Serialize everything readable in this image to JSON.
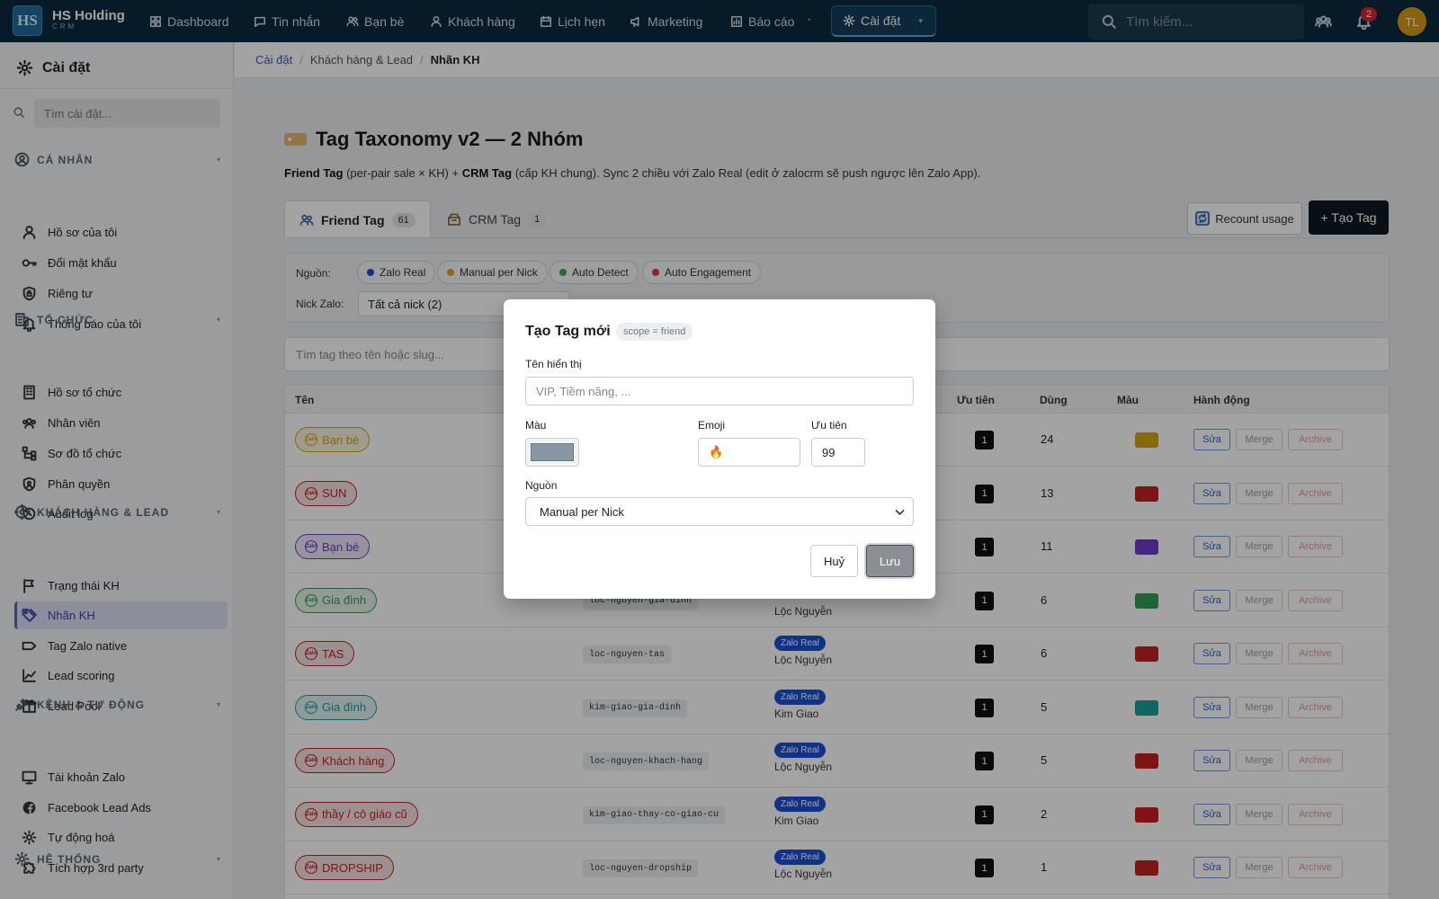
{
  "topnav": {
    "logo": "HS",
    "brand_name": "HS Holding",
    "brand_sub": "CRM",
    "items": [
      {
        "label": "Dashboard"
      },
      {
        "label": "Tin nhắn"
      },
      {
        "label": "Bạn bè"
      },
      {
        "label": "Khách hàng"
      },
      {
        "label": "Lịch hẹn"
      },
      {
        "label": "Marketing"
      },
      {
        "label": "Báo cáo"
      }
    ],
    "active_item": "Cài đặt",
    "search_placeholder": "Tìm kiếm...",
    "notification_count": "2",
    "avatar_initials": "TL"
  },
  "sidebar": {
    "title": "Cài đặt",
    "search_placeholder": "Tìm cài đặt...",
    "sections": [
      {
        "title": "CÁ NHÂN",
        "items": [
          "Hồ sơ của tôi",
          "Đổi mật khẩu",
          "Riêng tư",
          "Thông báo của tôi"
        ]
      },
      {
        "title": "TỔ CHỨC",
        "items": [
          "Hồ sơ tổ chức",
          "Nhân viên",
          "Sơ đồ tổ chức",
          "Phân quyền",
          "Audit log"
        ]
      },
      {
        "title": "KHÁCH HÀNG & LEAD",
        "items": [
          "Trạng thái KH",
          "Nhãn KH",
          "Tag Zalo native",
          "Lead scoring",
          "Lead Pool"
        ]
      },
      {
        "title": "KÊNH & TỰ ĐỘNG",
        "items": [
          "Tài khoản Zalo",
          "Facebook Lead Ads",
          "Tự động hoá",
          "Tích hợp 3rd party"
        ]
      },
      {
        "title": "HỆ THỐNG",
        "items": []
      }
    ],
    "active_item": "Nhãn KH"
  },
  "breadcrumb": [
    "Cài đặt",
    "Khách hàng & Lead",
    "Nhãn KH"
  ],
  "page": {
    "title": "Tag Taxonomy v2 — 2 Nhóm",
    "desc_b1": "Friend Tag",
    "desc_t1": " (per-pair sale × KH) + ",
    "desc_b2": "CRM Tag",
    "desc_t2": " (cấp KH chung). Sync 2 chiều với Zalo Real (edit ở zalocrm sẽ push ngược lên Zalo App).",
    "tabs": [
      {
        "label": "Friend Tag",
        "count": "61"
      },
      {
        "label": "CRM Tag",
        "count": "1"
      }
    ],
    "recount_label": "Recount usage",
    "create_label": "+ Tạo Tag",
    "filters": {
      "source_label": "Nguồn:",
      "sources": [
        {
          "label": "Zalo Real",
          "color": "#1a4fd6"
        },
        {
          "label": "Manual per Nick",
          "color": "#e0a21a"
        },
        {
          "label": "Auto Detect",
          "color": "#3aa756"
        },
        {
          "label": "Auto Engagement",
          "color": "#d63a3a"
        }
      ],
      "nick_label": "Nick Zalo:",
      "nick_value": "Tất cả nick (2)"
    },
    "tag_search_placeholder": "Tìm tag theo tên hoặc slug..."
  },
  "table": {
    "headers": {
      "name": "Tên",
      "priority": "Ưu tiên",
      "used": "Dùng",
      "color": "Màu",
      "actions": "Hành động"
    },
    "action_labels": {
      "edit": "Sửa",
      "merge": "Merge",
      "archive": "Archive"
    },
    "rows": [
      {
        "name": "Bạn bè",
        "slug": "",
        "source": "",
        "nick": "",
        "priority": "1",
        "used": "24",
        "color": "#d4a40c"
      },
      {
        "name": "SUN",
        "slug": "",
        "source": "",
        "nick": "",
        "priority": "1",
        "used": "13",
        "color": "#c81e1e"
      },
      {
        "name": "Bạn bè",
        "slug": "",
        "source": "",
        "nick": "",
        "priority": "1",
        "used": "11",
        "color": "#6d3bc8"
      },
      {
        "name": "Gia đình",
        "slug": "loc-nguyen-gia-dinh",
        "source": "",
        "nick": "Lộc Nguyễn",
        "priority": "1",
        "used": "6",
        "color": "#2e9e55"
      },
      {
        "name": "TAS",
        "slug": "loc-nguyen-tas",
        "source": "Zalo Real",
        "nick": "Lộc Nguyễn",
        "priority": "1",
        "used": "6",
        "color": "#c81e1e"
      },
      {
        "name": "Gia đình",
        "slug": "kim-giao-gia-dinh",
        "source": "Zalo Real",
        "nick": "Kim Giao",
        "priority": "1",
        "used": "5",
        "color": "#14a39a"
      },
      {
        "name": "Khách hàng",
        "slug": "loc-nguyen-khach-hang",
        "source": "Zalo Real",
        "nick": "Lộc Nguyễn",
        "priority": "1",
        "used": "5",
        "color": "#c81e1e"
      },
      {
        "name": "thầy / cô giáo cũ",
        "slug": "kim-giao-thay-co-giao-cu",
        "source": "Zalo Real",
        "nick": "Kim Giao",
        "priority": "1",
        "used": "2",
        "color": "#c81e1e"
      },
      {
        "name": "DROPSHIP",
        "slug": "loc-nguyen-dropship",
        "source": "Zalo Real",
        "nick": "Lộc Nguyễn",
        "priority": "1",
        "used": "1",
        "color": "#c81e1e"
      }
    ]
  },
  "modal": {
    "title": "Tạo Tag mới",
    "scope": "scope = friend",
    "name_label": "Tên hiển thị",
    "name_placeholder": "VIP, Tiềm năng, ...",
    "color_label": "Màu",
    "color_value": "#8896a3",
    "emoji_label": "Emoji",
    "emoji_value": "🔥",
    "priority_label": "Ưu tiên",
    "priority_value": "99",
    "source_label": "Nguồn",
    "source_value": "Manual per Nick",
    "cancel_label": "Huỷ",
    "save_label": "Lưu"
  }
}
